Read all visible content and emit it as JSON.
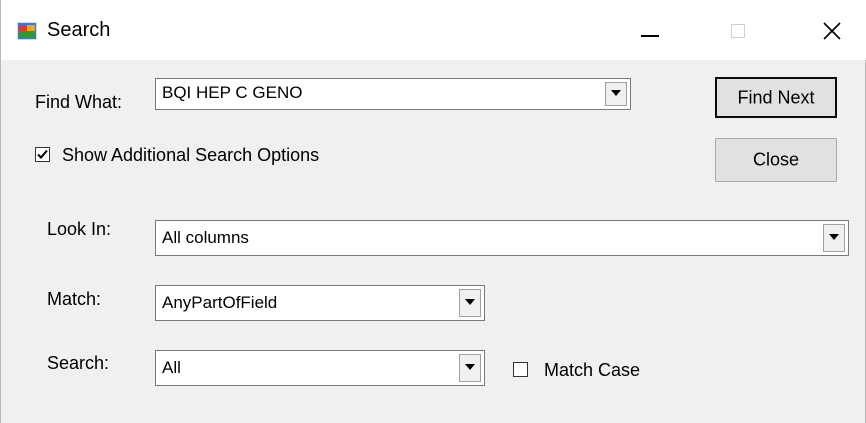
{
  "window": {
    "title": "Search",
    "icon": "app-window-icon",
    "controls": [
      "minimize-icon",
      "maximize-icon",
      "close-icon"
    ]
  },
  "find_what": {
    "label": "Find What:",
    "value": "BQI HEP C GENO"
  },
  "buttons": {
    "find_next": "Find Next",
    "close": "Close"
  },
  "show_additional": {
    "label": "Show Additional Search Options",
    "checked": true
  },
  "look_in": {
    "label": "Look In:",
    "value": "All columns"
  },
  "match": {
    "label": "Match:",
    "value": "AnyPartOfField"
  },
  "search": {
    "label": "Search:",
    "value": "All"
  },
  "match_case": {
    "label": "Match Case",
    "checked": false
  }
}
